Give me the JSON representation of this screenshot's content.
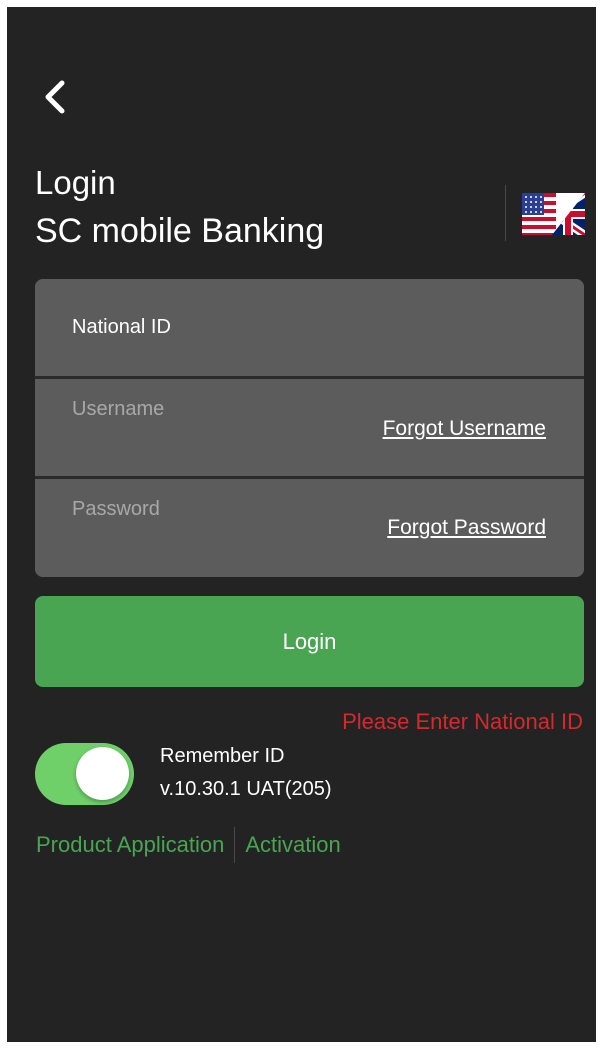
{
  "header": {
    "back_icon": "chevron-left-icon",
    "title_line1": "Login",
    "title_line2": "SC mobile Banking",
    "language_flag_icon": "uk-us-flag-icon"
  },
  "form": {
    "national_id": {
      "label": "National ID",
      "value": ""
    },
    "username": {
      "placeholder": "Username",
      "value": "",
      "forgot_link": "Forgot Username"
    },
    "password": {
      "placeholder": "Password",
      "value": "",
      "forgot_link": "Forgot Password"
    },
    "login_button": "Login"
  },
  "error": {
    "message": "Please Enter National ID",
    "color": "#d42a2a"
  },
  "remember": {
    "label": "Remember ID",
    "enabled": true,
    "version": "v.10.30.1 UAT(205)"
  },
  "links": {
    "product_application": "Product Application",
    "activation": "Activation"
  },
  "colors": {
    "background": "#232323",
    "field": "#5c5c5c",
    "accent_green": "#4aa553",
    "toggle_green": "#6fd06a",
    "error_red": "#d42a2a"
  }
}
